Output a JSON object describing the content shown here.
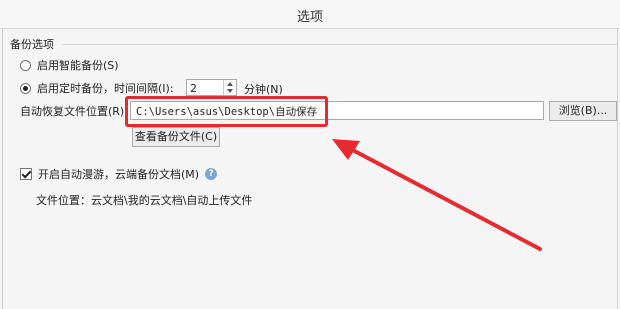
{
  "window": {
    "title": "选项"
  },
  "backup": {
    "group_label": "备份选项",
    "smart_backup_label": "启用智能备份(S)",
    "timed_backup_label": "启用定时备份，时间间隔(I):",
    "interval_value": "2",
    "interval_unit": "分钟(N)",
    "restore_path_label": "自动恢复文件位置(R):",
    "restore_path_value": "C:\\Users\\asus\\Desktop\\自动保存",
    "browse_label": "浏览(B)...",
    "view_backup_label": "查看备份文件(C)"
  },
  "cloud": {
    "roaming_label": "开启自动漫游，云端备份文档(M)",
    "help_glyph": "?",
    "location_text": "文件位置：云文档\\我的云文档\\自动上传文件"
  },
  "annotation": {
    "color": "#e52b2f"
  }
}
